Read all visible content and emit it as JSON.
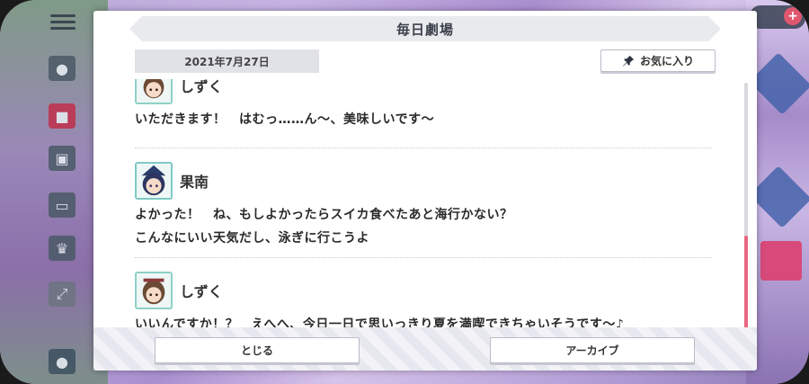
{
  "dialog": {
    "title": "毎日劇場",
    "date": "2021年7月27日",
    "favorite_label": "お気に入り",
    "close_label": "とじる",
    "archive_label": "アーカイブ"
  },
  "messages": [
    {
      "speaker": "しずく",
      "lines": [
        "いただきます！　はむっ……ん～、美味しいです～"
      ]
    },
    {
      "speaker": "果南",
      "lines": [
        "よかった！　ね、もしよかったらスイカ食べたあと海行かない？",
        "こんなにいい天気だし、泳ぎに行こうよ"
      ]
    },
    {
      "speaker": "しずく",
      "lines": [
        "いいんですか！？　えへへ、今日一日で思いっきり夏を満喫できちゃいそうです～♪"
      ]
    }
  ],
  "scroll": {
    "position_fraction": 0.62,
    "visible_fraction": 0.38
  },
  "colors": {
    "accent": "#e8687f",
    "header_bg": "#e9eaee"
  },
  "icons": {
    "favorite": "pin-icon"
  }
}
